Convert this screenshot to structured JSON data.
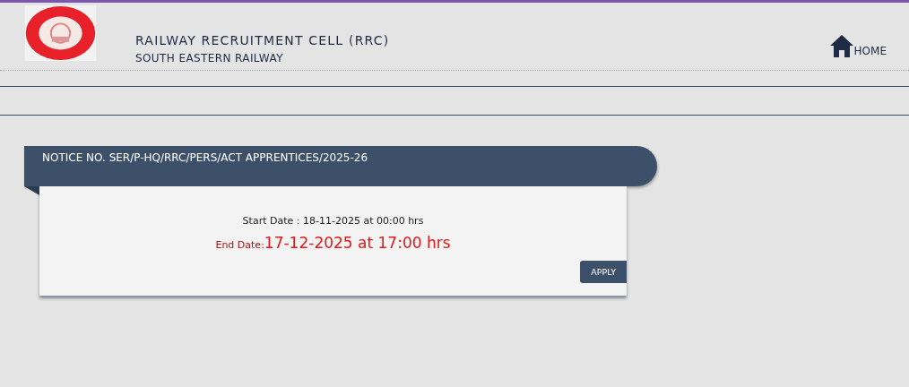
{
  "header": {
    "title": "RAILWAY RECRUITMENT CELL (RRC)",
    "subtitle": "SOUTH EASTERN RAILWAY",
    "home_link": "HOME"
  },
  "notice": {
    "title": "NOTICE NO. SER/P-HQ/RRC/PERS/ACT APPRENTICES/2025-26",
    "start_date": "Start Date : 18-11-2025 at 00:00 hrs",
    "end_label": "End Date:",
    "end_value": "17-12-2025 at 17:00 hrs",
    "button": "APPLY"
  }
}
